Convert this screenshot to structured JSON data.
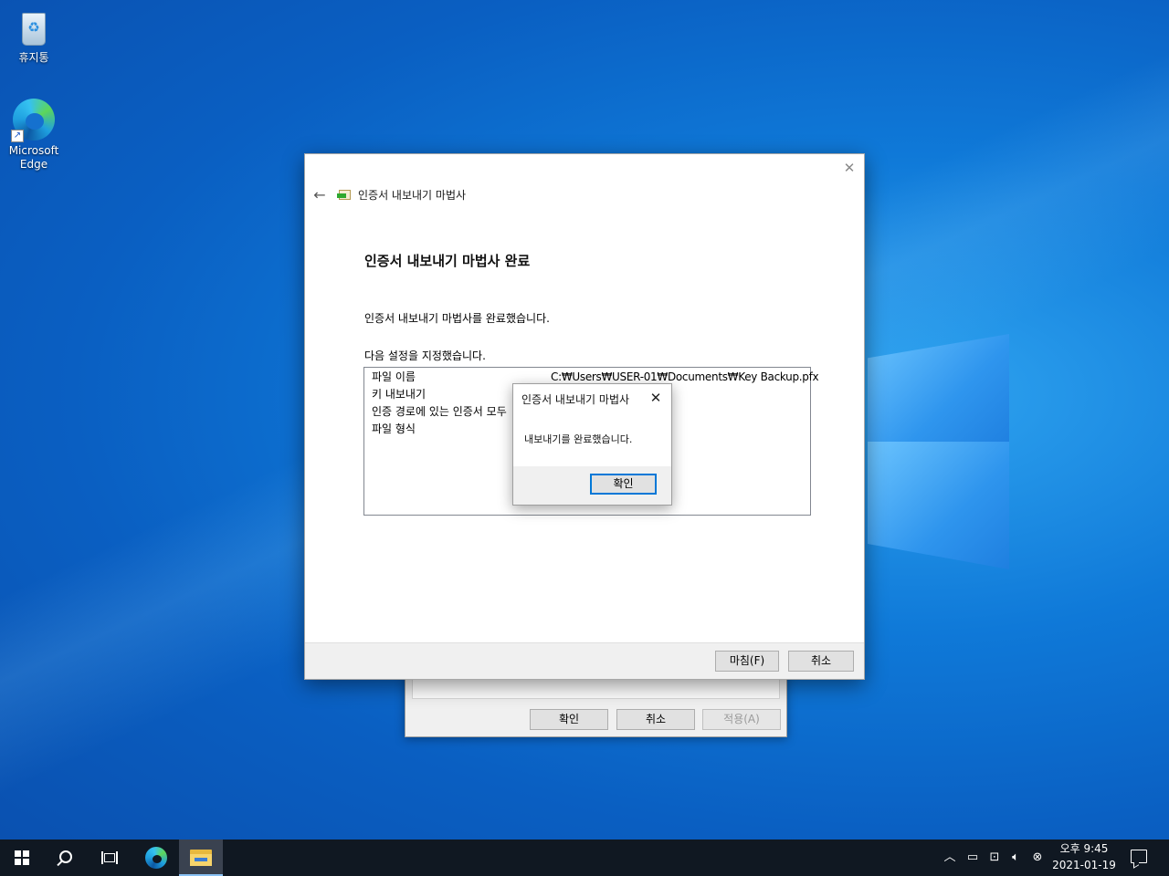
{
  "desktop": {
    "icons": [
      {
        "label": "휴지통",
        "icon": "recycle-bin-icon"
      },
      {
        "label": "Microsoft Edge",
        "icon": "edge-icon"
      }
    ]
  },
  "background_dialog": {
    "ok_label": "확인",
    "cancel_label": "취소",
    "apply_label": "적용(A)"
  },
  "wizard": {
    "app_title": "인증서 내보내기 마법사",
    "heading": "인증서 내보내기 마법사 완료",
    "completed_text": "인증서 내보내기 마법사를 완료했습니다.",
    "settings_intro": "다음 설정을 지정했습니다.",
    "settings": [
      {
        "key": "파일 이름",
        "value": "C:₩Users₩USER-01₩Documents₩Key Backup.pfx"
      },
      {
        "key": "키 내보내기",
        "value": ""
      },
      {
        "key": "인증 경로에 있는 인증서 모두",
        "value": ""
      },
      {
        "key": "파일 형식",
        "value": ""
      }
    ],
    "finish_label": "마침(F)",
    "cancel_label": "취소"
  },
  "message_box": {
    "title": "인증서 내보내기 마법사",
    "text": "내보내기를 완료했습니다.",
    "ok_label": "확인"
  },
  "taskbar": {
    "clock_time": "오후 9:45",
    "clock_date": "2021-01-19",
    "accent": "#0078d7"
  }
}
